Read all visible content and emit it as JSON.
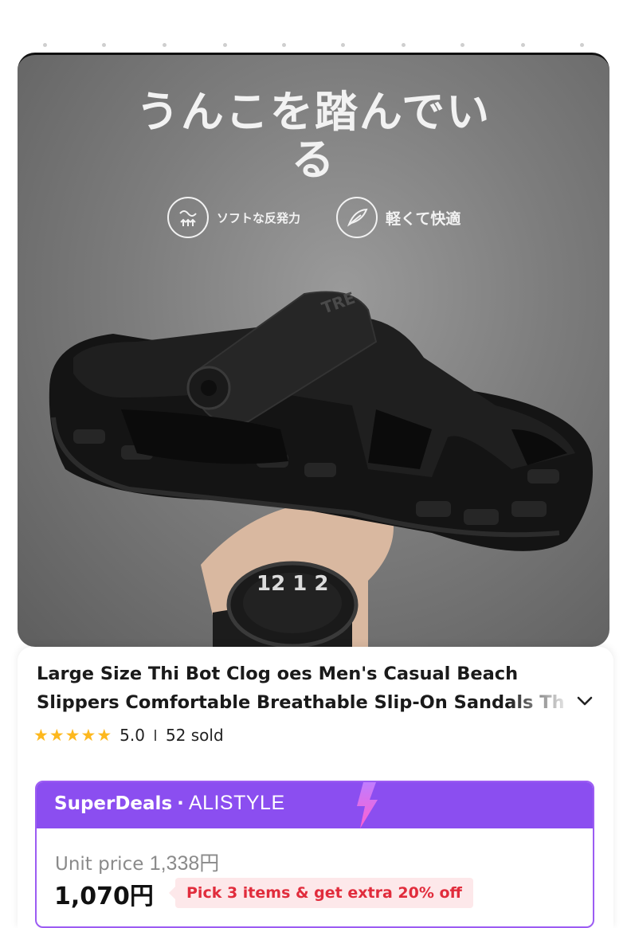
{
  "hero": {
    "headline_line1": "うんこを踏んでい",
    "headline_line2": "る",
    "features": [
      {
        "label": "ソフトな反発力",
        "icon": "springy-cushion-icon"
      },
      {
        "label": "軽くて快適",
        "icon": "feather-icon"
      }
    ]
  },
  "product": {
    "title_line1": "Large Size Thi Bot Clog oes Men's Casual Beach",
    "title_line2": "Slippers Comfortable Breathable Slip-On Sandals Th",
    "rating": "5.0",
    "sold": "52 sold",
    "stars": 5
  },
  "deal": {
    "label": "SuperDeals",
    "separator": "·",
    "store": "ALISTYLE",
    "unit_price_label": "Unit price",
    "unit_price_value": "1,338円",
    "price": "1,070円",
    "promo": "Pick 3 items & get extra 20% off"
  },
  "colors": {
    "accent_purple": "#8b4ef0",
    "promo_red": "#e12c3c",
    "promo_bg": "#fde8ea",
    "star_yellow": "#fdb81e"
  }
}
